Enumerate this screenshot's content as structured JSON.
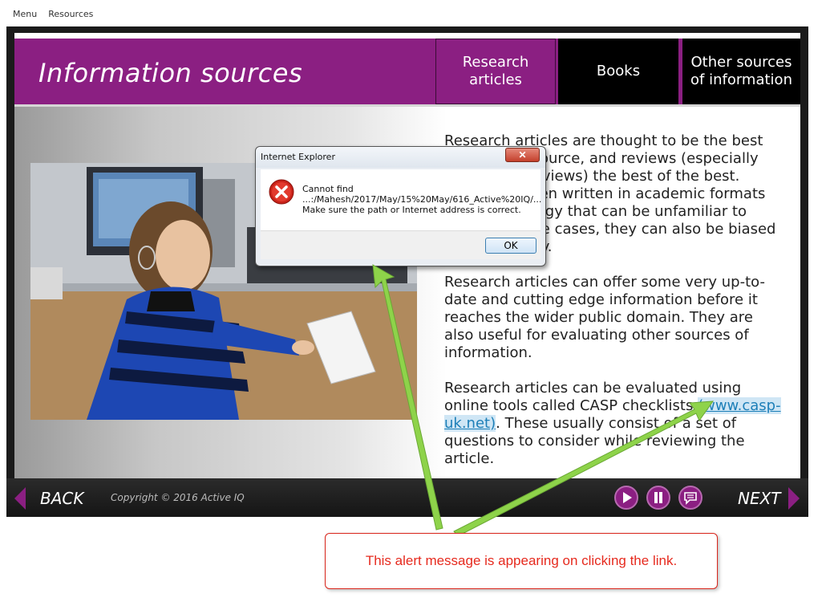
{
  "topmenu": {
    "menu": "Menu",
    "resources": "Resources"
  },
  "header": {
    "title": "Information sources",
    "tabs": [
      {
        "label": "Research articles"
      },
      {
        "label": "Books"
      },
      {
        "label": "Other sources of information"
      }
    ]
  },
  "content": {
    "paragraph1": "Research articles are thought to be the best information source, and reviews (especially systematic reviews) the best of the best. These are often written in academic formats and terminology that can be unfamiliar to some. In some cases, they can also be biased in their quality.",
    "paragraph2": "Research articles can offer some very up-to-date and cutting edge information before it reaches the wider public domain. They are also useful for evaluating other sources of information.",
    "paragraph3_before": "Research articles can be evaluated using online tools called CASP checklists ",
    "paragraph3_link": "(www.casp-uk.net)",
    "paragraph3_after": ". These usually consist of a set of questions to consider while reviewing the article."
  },
  "dialog": {
    "title": "Internet Explorer",
    "close_label": "✕",
    "line1": "Cannot find",
    "line2": "...:/Mahesh/2017/May/15%20May/616_Active%20IQ/...",
    "line3": "Make sure the path or Internet address is correct.",
    "ok_label": "OK"
  },
  "footer": {
    "back_label": "BACK",
    "copyright": "Copyright © 2016 Active IQ",
    "next_label": "NEXT"
  },
  "annotation": {
    "text": "This alert message is appearing on clicking the link."
  },
  "colors": {
    "brand_purple": "#8b1f82",
    "link_blue": "#1d7fb8",
    "annotation_red": "#e62a1e",
    "arrow_green": "#8ed34a"
  },
  "icons": {
    "error": "error-circle-x-icon",
    "play": "play-icon",
    "pause": "pause-icon",
    "transcript": "speech-bubble-icon"
  }
}
